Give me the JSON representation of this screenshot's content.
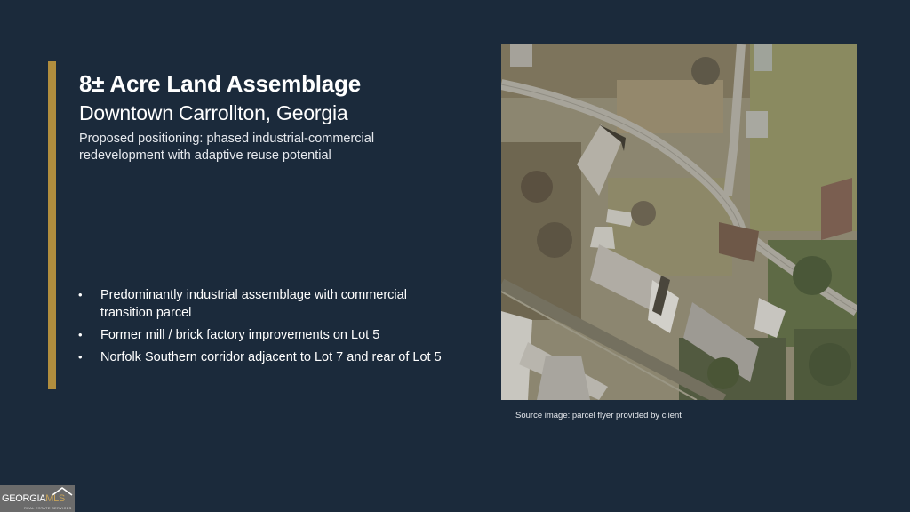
{
  "slide": {
    "title": "8± Acre Land Assemblage",
    "subtitle": "Downtown Carrollton, Georgia",
    "tagline": "Proposed positioning: phased industrial-commercial redevelopment with adaptive reuse potential",
    "bullets": [
      "Predominantly industrial assemblage with commercial transition parcel",
      "Former mill / brick factory improvements on Lot 5",
      "Norfolk Southern corridor adjacent to Lot 7 and rear of Lot 5"
    ],
    "caption": "Source image: parcel flyer provided by client"
  },
  "logo": {
    "brand_main": "GEORGIA",
    "brand_accent": "MLS",
    "tagline": "REAL ESTATE SERVICES"
  },
  "colors": {
    "background": "#1b2a3b",
    "accent": "#b08d3e",
    "text": "#ffffff"
  }
}
